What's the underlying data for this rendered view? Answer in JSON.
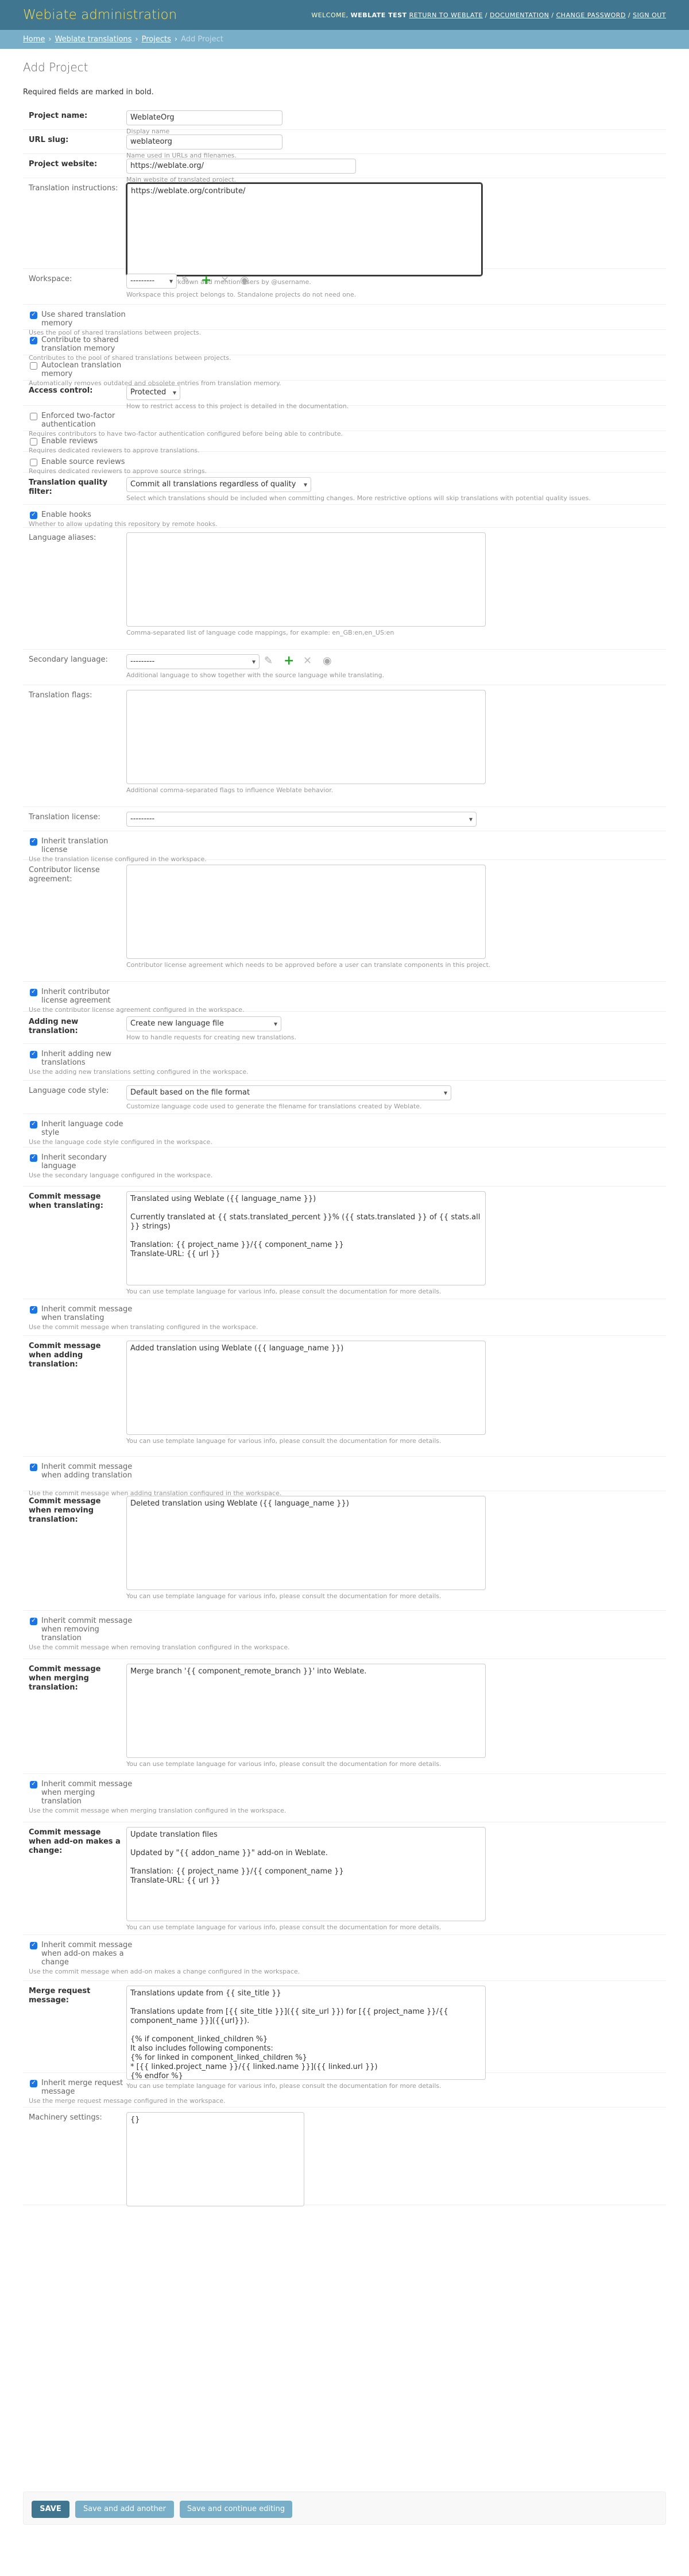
{
  "header": {
    "brand": "Webiate administration",
    "welcome": "WELCOME,",
    "user": "WEBLATE TEST",
    "sep": "/",
    "links": [
      "RETURN TO WEBLATE",
      "DOCUMENTATION",
      "CHANGE PASSWORD",
      "SIGN OUT"
    ]
  },
  "breadcrumbs": [
    "Home",
    "Weblate translations",
    "Projects",
    "Add Project"
  ],
  "page": {
    "title": "Add Project",
    "required_note": "Required fields are marked in bold."
  },
  "fields": {
    "name": {
      "label": "Project name:",
      "value": "WeblateOrg",
      "help": "Display name"
    },
    "slug": {
      "label": "URL slug:",
      "value": "weblateorg",
      "help": "Name used in URLs and filenames."
    },
    "web": {
      "label": "Project website:",
      "value": "https://weblate.org/",
      "help": "Main website of translated project."
    },
    "instructions": {
      "label": "Translation instructions:",
      "value": "https://weblate.org/contribute/",
      "help": "You can use Markdown and mention users by @username."
    },
    "workspace": {
      "label": "Workspace:",
      "value": "---------",
      "help": "Workspace this project belongs to. Standalone projects do not need one."
    },
    "use_shared_tm": {
      "label": "Use shared translation memory",
      "help": "Uses the pool of shared translations between projects."
    },
    "contribute_shared_tm": {
      "label": "Contribute to shared translation memory",
      "help": "Contributes to the pool of shared translations between projects."
    },
    "autoclean_tm": {
      "label": "Autoclean translation memory",
      "help": "Automatically removes outdated and obsolete entries from translation memory."
    },
    "access": {
      "label": "Access control:",
      "value": "Protected",
      "help": "How to restrict access to this project is detailed in the documentation."
    },
    "enforce_2fa": {
      "label": "Enforced two-factor authentication",
      "help": "Requires contributors to have two-factor authentication configured before being able to contribute."
    },
    "reviews": {
      "label": "Enable reviews",
      "help": "Requires dedicated reviewers to approve translations."
    },
    "source_reviews": {
      "label": "Enable source reviews",
      "help": "Requires dedicated reviewers to approve source strings."
    },
    "quality_filter": {
      "label": "Translation quality filter:",
      "value": "Commit all translations regardless of quality",
      "help": "Select which translations should be included when committing changes. More restrictive options will skip translations with potential quality issues."
    },
    "hooks": {
      "label": "Enable hooks",
      "help": "Whether to allow updating this repository by remote hooks."
    },
    "aliases": {
      "label": "Language aliases:",
      "value": "",
      "help": "Comma-separated list of language code mappings, for example: en_GB:en,en_US:en"
    },
    "secondary": {
      "label": "Secondary language:",
      "value": "---------",
      "help": "Additional language to show together with the source language while translating."
    },
    "flags": {
      "label": "Translation flags:",
      "value": "",
      "help": "Additional comma-separated flags to influence Weblate behavior."
    },
    "license": {
      "label": "Translation license:",
      "value": "---------"
    },
    "inherit_license": {
      "label": "Inherit translation license",
      "help": "Use the translation license configured in the workspace."
    },
    "agreement": {
      "label": "Contributor license agreement:",
      "value": "",
      "help": "Contributor license agreement which needs to be approved before a user can translate components in this project."
    },
    "inherit_agreement": {
      "label": "Inherit contributor license agreement",
      "help": "Use the contributor license agreement configured in the workspace."
    },
    "new_lang": {
      "label": "Adding new translation:",
      "value": "Create new language file",
      "help": "How to handle requests for creating new translations."
    },
    "inherit_new_lang": {
      "label": "Inherit adding new translations",
      "help": "Use the adding new translations setting configured in the workspace."
    },
    "code_style": {
      "label": "Language code style:",
      "value": "Default based on the file format",
      "help": "Customize language code used to generate the filename for translations created by Weblate."
    },
    "inherit_code_style": {
      "label": "Inherit language code style",
      "help": "Use the language code style configured in the workspace."
    },
    "inherit_secondary": {
      "label": "Inherit secondary language",
      "help": "Use the secondary language configured in the workspace."
    },
    "commit_translating": {
      "label": "Commit message when translating:",
      "value": "Translated using Weblate ({{ language_name }})\n\nCurrently translated at {{ stats.translated_percent }}% ({{ stats.translated }} of {{ stats.all }} strings)\n\nTranslation: {{ project_name }}/{{ component_name }}\nTranslate-URL: {{ url }}",
      "help": "You can use template language for various info, please consult the documentation for more details."
    },
    "inherit_commit_translating": {
      "label": "Inherit commit message when translating",
      "help": "Use the commit message when translating configured in the workspace."
    },
    "commit_adding": {
      "label": "Commit message when adding translation:",
      "value": "Added translation using Weblate ({{ language_name }})",
      "help": "You can use template language for various info, please consult the documentation for more details."
    },
    "inherit_commit_adding": {
      "label": "Inherit commit message when adding translation",
      "help": "Use the commit message when adding translation configured in the workspace."
    },
    "commit_removing": {
      "label": "Commit message when removing translation:",
      "value": "Deleted translation using Weblate ({{ language_name }})",
      "help": "You can use template language for various info, please consult the documentation for more details."
    },
    "inherit_commit_removing": {
      "label": "Inherit commit message when removing translation",
      "help": "Use the commit message when removing translation configured in the workspace."
    },
    "commit_merging": {
      "label": "Commit message when merging translation:",
      "value": "Merge branch '{{ component_remote_branch }}' into Weblate.",
      "help": "You can use template language for various info, please consult the documentation for more details."
    },
    "inherit_commit_merging": {
      "label": "Inherit commit message when merging translation",
      "help": "Use the commit message when merging translation configured in the workspace."
    },
    "commit_addon": {
      "label": "Commit message when add-on makes a change:",
      "value": "Update translation files\n\nUpdated by \"{{ addon_name }}\" add-on in Weblate.\n\nTranslation: {{ project_name }}/{{ component_name }}\nTranslate-URL: {{ url }}",
      "help": "You can use template language for various info, please consult the documentation for more details."
    },
    "inherit_commit_addon": {
      "label": "Inherit commit message when add-on makes a change",
      "help": "Use the commit message when add-on makes a change configured in the workspace."
    },
    "merge_request": {
      "label": "Merge request message:",
      "value": "Translations update from {{ site_title }}\n\nTranslations update from [{{ site_title }}]({{ site_url }}) for [{{ project_name }}/{{ component_name }}]({{url}}).\n\n{% if component_linked_children %}\nIt also includes following components:\n{% for linked in component_linked_children %}\n* [{{ linked.project_name }}/{{ linked.name }}]({{ linked.url }})\n{% endfor %}",
      "help": "You can use template language for various info, please consult the documentation for more details."
    },
    "inherit_merge_request": {
      "label": "Inherit merge request message",
      "help": "Use the merge request message configured in the workspace."
    },
    "machinery": {
      "label": "Machinery settings:",
      "value": "{}"
    }
  },
  "buttons": {
    "save": "SAVE",
    "add_another": "Save and add another",
    "continue": "Save and continue editing"
  },
  "checked": {
    "use_shared_tm": true,
    "contribute_shared_tm": true,
    "autoclean_tm": false,
    "enforce_2fa": false,
    "reviews": false,
    "source_reviews": false,
    "hooks": true,
    "inherit_license": true,
    "inherit_agreement": true,
    "inherit_new_lang": true,
    "inherit_code_style": true,
    "inherit_secondary": true,
    "inherit_commit_translating": true,
    "inherit_commit_adding": true,
    "inherit_commit_removing": true,
    "inherit_commit_merging": true,
    "inherit_commit_addon": true,
    "inherit_merge_request": true
  }
}
